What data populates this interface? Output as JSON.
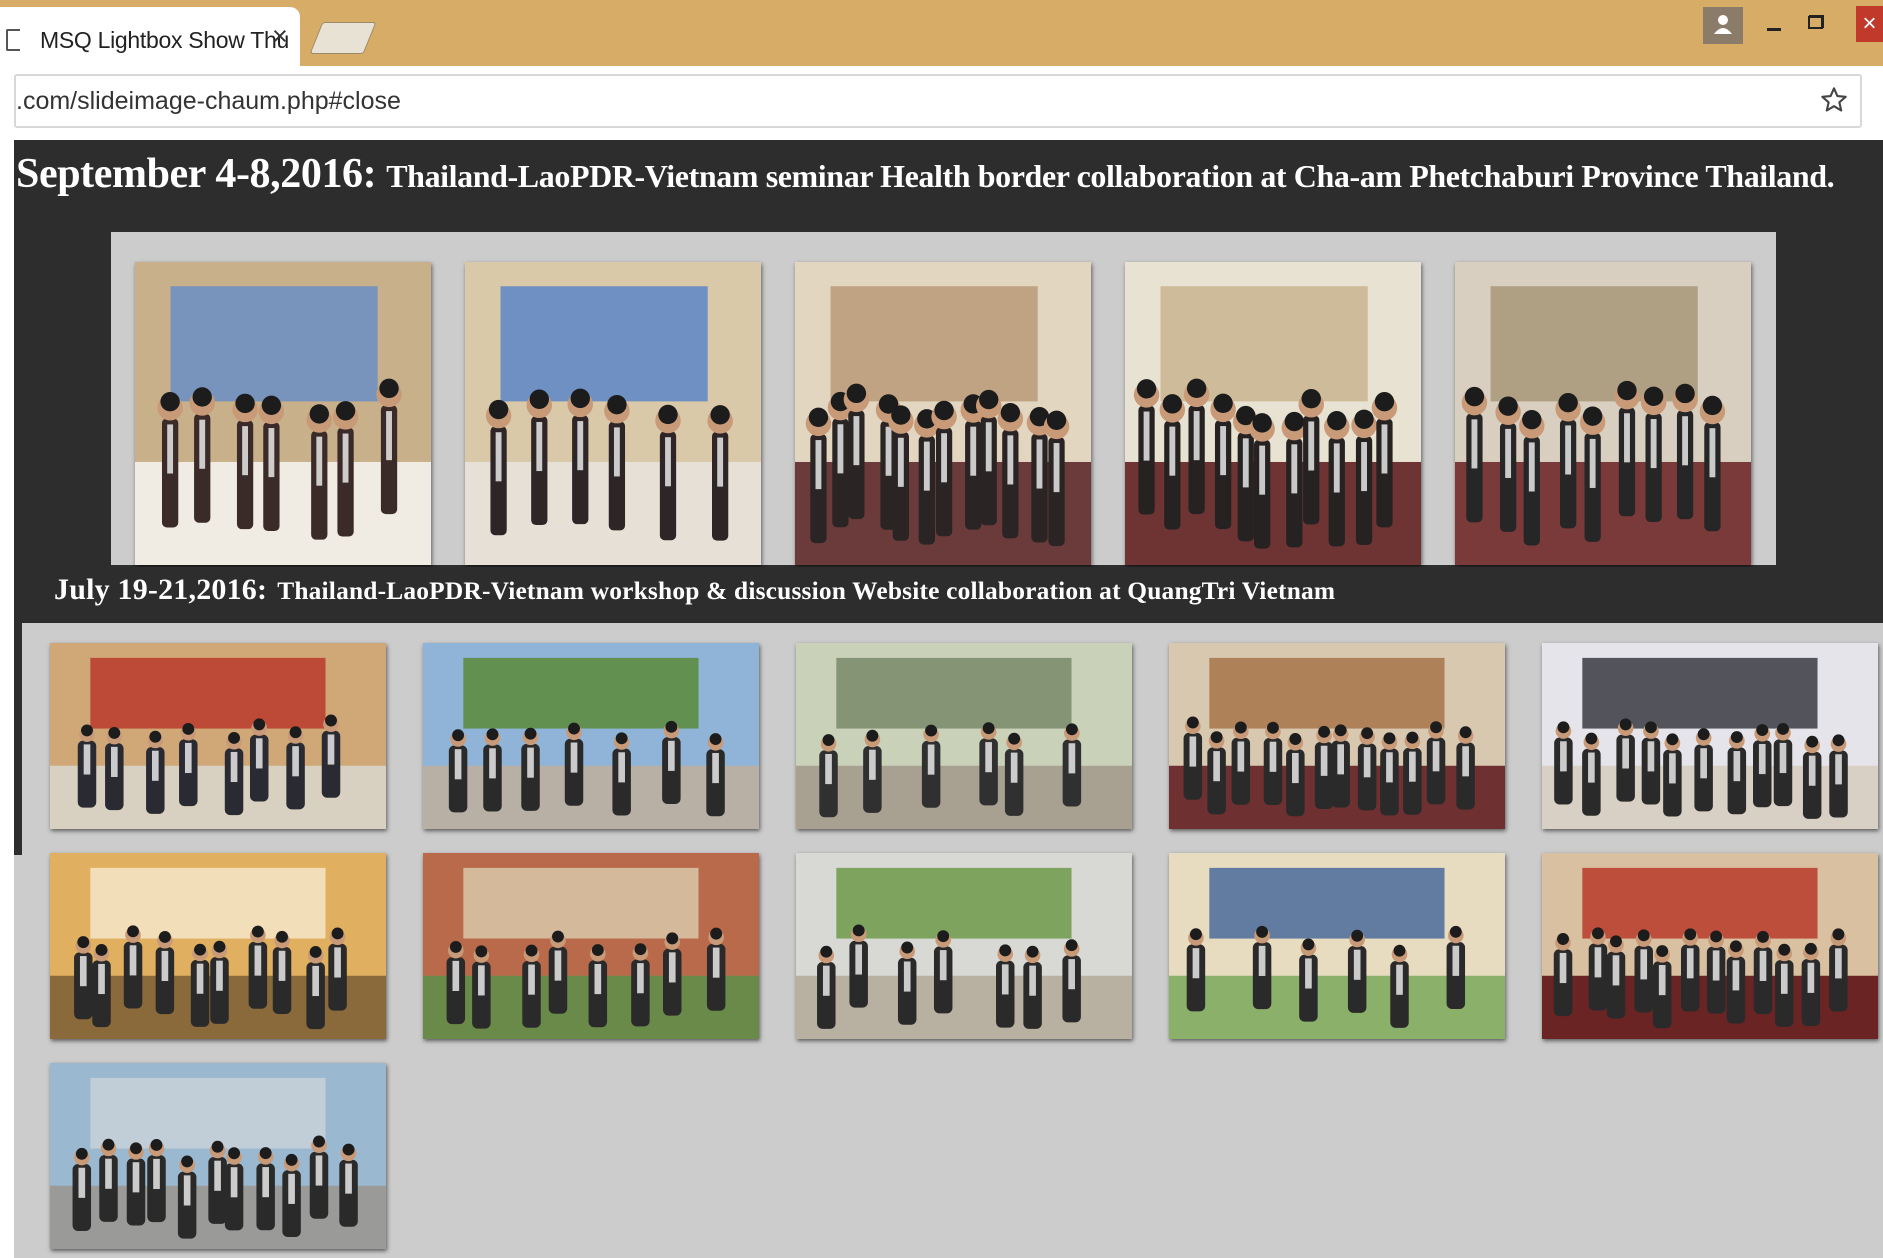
{
  "browser": {
    "tab_title": "MSQ Lightbox Show Thu",
    "tab_close": "×",
    "address": ".com/slideimage-chaum.php#close",
    "window_close": "×"
  },
  "events": [
    {
      "date": "September 4-8,2016:",
      "description": "Thailand-LaoPDR-Vietnam seminar Health border collaboration at Cha-am Phetchaburi Province Thailand.",
      "photo_count": 5
    },
    {
      "date": "July 19-21,2016:",
      "description": "Thailand-LaoPDR-Vietnam workshop & discussion Website collaboration at QuangTri Vietnam",
      "photo_count": 11
    }
  ],
  "colors": {
    "tabstrip": "#d6ac66",
    "page_dark": "#2d2d2d",
    "gallery_bg": "#cccccc"
  }
}
